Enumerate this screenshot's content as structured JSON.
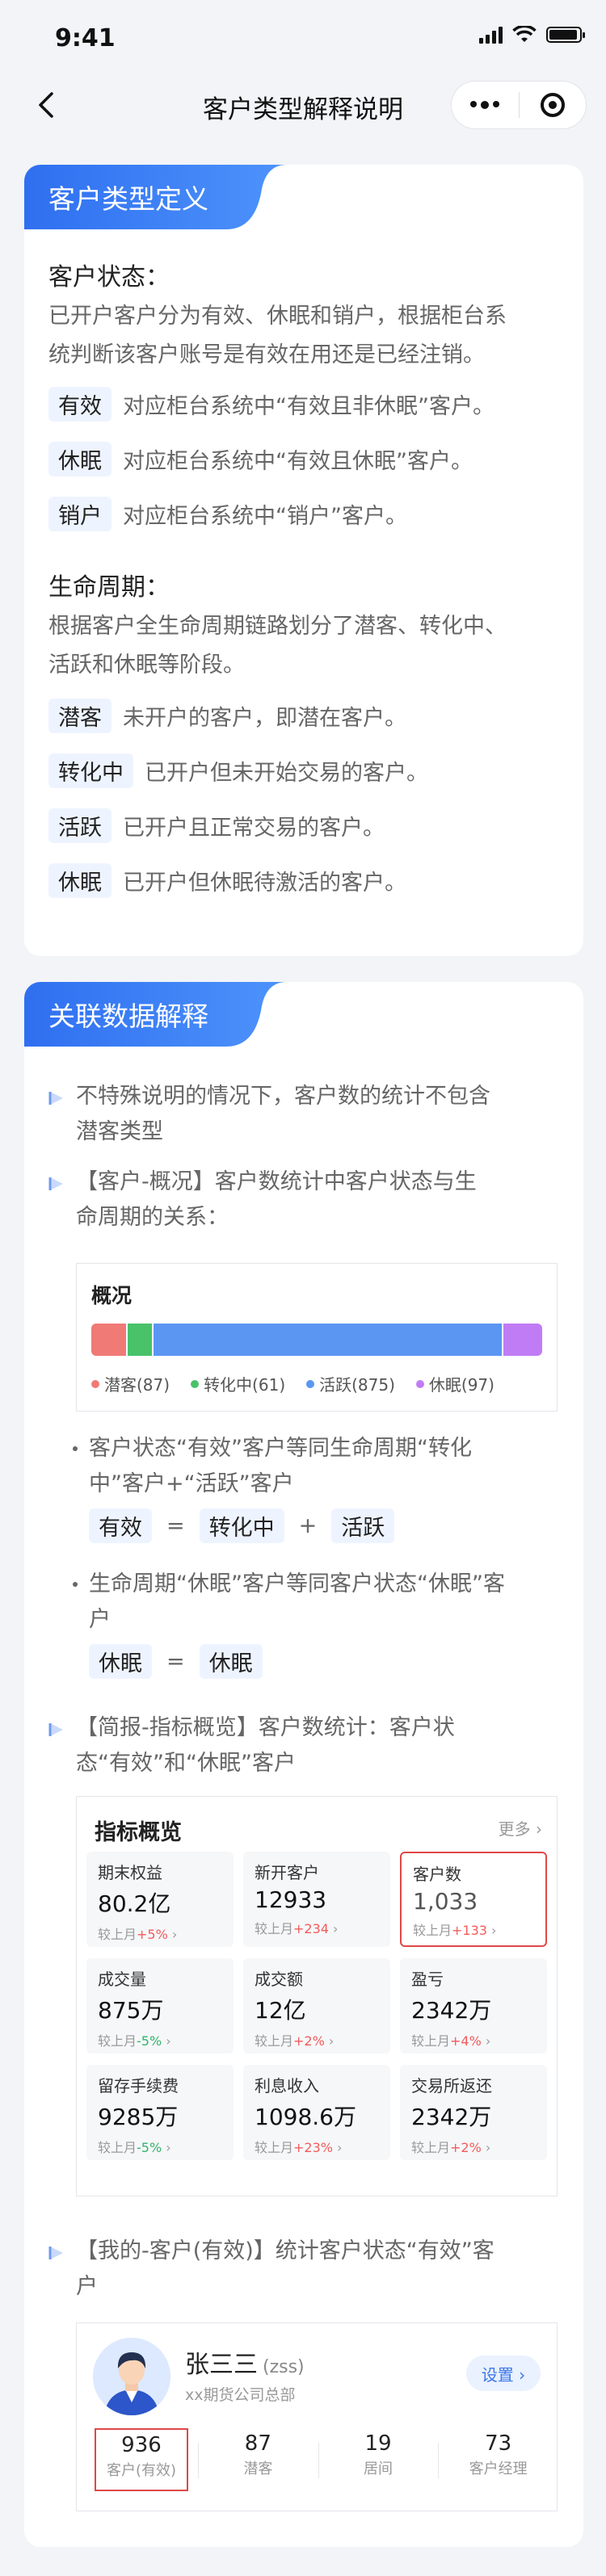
{
  "status": {
    "time": "9:41"
  },
  "nav": {
    "title": "客户类型解释说明"
  },
  "colors": {
    "accent": "#3b7ff5",
    "prospect": "#f07a76",
    "converting": "#49c26a",
    "active": "#5a96f2",
    "dormant": "#c07cf5",
    "highlight_border": "#e04848"
  },
  "section1": {
    "title": "客户类型定义",
    "status_heading": "客户状态：",
    "status_desc_line1": "已开户客户分为有效、休眠和销户，根据柜台系",
    "status_desc_line2": "统判断该客户账号是有效在用还是已经注销。",
    "status_items": [
      {
        "tag": "有效",
        "desc": "对应柜台系统中“有效且非休眠”客户。"
      },
      {
        "tag": "休眠",
        "desc": "对应柜台系统中“有效且休眠”客户。"
      },
      {
        "tag": "销户",
        "desc": "对应柜台系统中“销户”客户。"
      }
    ],
    "lifecycle_heading": "生命周期：",
    "lifecycle_desc_line1": "根据客户全生命周期链路划分了潜客、转化中、",
    "lifecycle_desc_line2": "活跃和休眠等阶段。",
    "lifecycle_items": [
      {
        "tag": "潜客",
        "desc": "未开户的客户，即潜在客户。"
      },
      {
        "tag": "转化中",
        "desc": "已开户但未开始交易的客户。"
      },
      {
        "tag": "活跃",
        "desc": "已开户且正常交易的客户。"
      },
      {
        "tag": "休眠",
        "desc": "已开户但休眠待激活的客户。"
      }
    ]
  },
  "section2": {
    "title": "关联数据解释",
    "note1_line1": "不特殊说明的情况下，客户数的统计不包含",
    "note1_line2": "潜客类型",
    "note2_line1": "【客户-概况】客户数统计中客户状态与生",
    "note2_line2": "命周期的关系：",
    "overview": {
      "title": "概况",
      "segments": [
        {
          "label": "潜客(87)",
          "value": 87,
          "color": "#f07a76"
        },
        {
          "label": "转化中(61)",
          "value": 61,
          "color": "#49c26a"
        },
        {
          "label": "活跃(875)",
          "value": 875,
          "color": "#5a96f2"
        },
        {
          "label": "休眠(97)",
          "value": 97,
          "color": "#c07cf5"
        }
      ]
    },
    "bullet1_line1": "客户状态“有效”客户等同生命周期“转化",
    "bullet1_line2": "中”客户+“活跃”客户",
    "eq1": {
      "a": "有效",
      "eq": "=",
      "b": "转化中",
      "plus": "+",
      "c": "活跃"
    },
    "bullet2_line1": "生命周期“休眠”客户等同客户状态“休眠”客",
    "bullet2_line2": "户",
    "eq2": {
      "a": "休眠",
      "eq": "=",
      "b": "休眠"
    },
    "note3_line1": "【简报-指标概览】客户数统计：客户状",
    "note3_line2": "态“有效”和“休眠”客户",
    "indicators": {
      "title": "指标概览",
      "more": "更多 ›",
      "cells": [
        {
          "label": "期末权益",
          "value": "80.2亿",
          "cmp": "较上月",
          "delta": "+5%",
          "dir": "up"
        },
        {
          "label": "新开客户",
          "value": "12933",
          "cmp": "较上月",
          "delta": "+234",
          "dir": "up"
        },
        {
          "label": "客户数",
          "value": "1,033",
          "cmp": "较上月",
          "delta": "+133",
          "dir": "up"
        },
        {
          "label": "成交量",
          "value": "875万",
          "cmp": "较上月",
          "delta": "-5%",
          "dir": "down"
        },
        {
          "label": "成交额",
          "value": "12亿",
          "cmp": "较上月",
          "delta": "+2%",
          "dir": "up"
        },
        {
          "label": "盈亏",
          "value": "2342万",
          "cmp": "较上月",
          "delta": "+4%",
          "dir": "up"
        },
        {
          "label": "留存手续费",
          "value": "9285万",
          "cmp": "较上月",
          "delta": "-5%",
          "dir": "down"
        },
        {
          "label": "利息收入",
          "value": "1098.6万",
          "cmp": "较上月",
          "delta": "+23%",
          "dir": "up"
        },
        {
          "label": "交易所返还",
          "value": "2342万",
          "cmp": "较上月",
          "delta": "+2%",
          "dir": "up"
        }
      ]
    },
    "note4_line1": "【我的-客户(有效)】统计客户状态“有效”客",
    "note4_line2": "户",
    "profile": {
      "name": "张三三",
      "account": "(zss)",
      "org": "xx期货公司总部",
      "settings": "设置 ›",
      "stats": [
        {
          "value": "936",
          "label": "客户(有效)"
        },
        {
          "value": "87",
          "label": "潜客"
        },
        {
          "value": "19",
          "label": "居间"
        },
        {
          "value": "73",
          "label": "客户经理"
        }
      ]
    }
  }
}
